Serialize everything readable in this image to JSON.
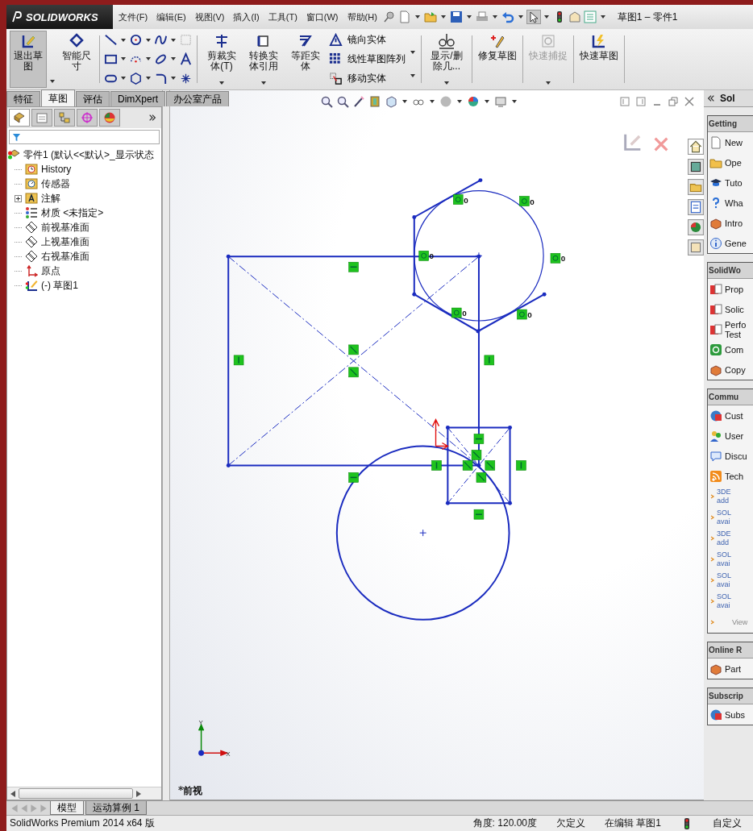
{
  "app": {
    "logo": "SOLIDWORKS",
    "menus": [
      "文件(F)",
      "编辑(E)",
      "视图(V)",
      "插入(I)",
      "工具(T)",
      "窗口(W)",
      "帮助(H)"
    ],
    "title": "草图1 – 零件1"
  },
  "ribbon": {
    "exit_sketch": {
      "label": "退出草图",
      "selected": true
    },
    "smart_dimension": "智能尺寸",
    "large_buttons": [
      {
        "label": "剪裁实体(T)",
        "dropdown": true
      },
      {
        "label": "转换实体引用",
        "dropdown": true
      },
      {
        "label": "等距实体",
        "dropdown": false
      }
    ],
    "list_buttons": [
      {
        "label": "镜向实体",
        "kind": "mirror"
      },
      {
        "label": "线性草图阵列",
        "kind": "pattern"
      },
      {
        "label": "移动实体",
        "kind": "move"
      }
    ],
    "right_buttons": [
      {
        "label": "显示/删除几...",
        "kind": "relations",
        "disabled": false,
        "dropdown": true
      },
      {
        "label": "修复草图",
        "kind": "repair",
        "disabled": false,
        "dropdown": false
      },
      {
        "label": "快速捕捉",
        "kind": "snap",
        "disabled": true,
        "dropdown": true
      },
      {
        "label": "快速草图",
        "kind": "quick",
        "disabled": false,
        "dropdown": false
      }
    ]
  },
  "tabs": [
    {
      "label": "特征",
      "selected": false
    },
    {
      "label": "草图",
      "selected": true
    },
    {
      "label": "评估",
      "selected": false
    },
    {
      "label": "DimXpert",
      "selected": false
    },
    {
      "label": "办公室产品",
      "selected": false
    }
  ],
  "panel_tabs": [
    {
      "kind": "tree",
      "selected": true
    },
    {
      "kind": "property",
      "selected": false
    },
    {
      "kind": "config",
      "selected": false
    },
    {
      "kind": "target",
      "selected": false
    },
    {
      "kind": "display",
      "selected": false
    }
  ],
  "feature_tree": {
    "root": "零件1  (默认<<默认>_显示状态",
    "items": [
      {
        "label": "History",
        "kind": "history"
      },
      {
        "label": "传感器",
        "kind": "sensor"
      },
      {
        "label": "注解",
        "kind": "annotation",
        "expanded": false
      },
      {
        "label": "材质 <未指定>",
        "kind": "material"
      },
      {
        "label": "前视基准面",
        "kind": "plane"
      },
      {
        "label": "上视基准面",
        "kind": "plane"
      },
      {
        "label": "右视基准面",
        "kind": "plane"
      },
      {
        "label": "原点",
        "kind": "origin"
      },
      {
        "label": "(-) 草图1",
        "kind": "sketch"
      }
    ]
  },
  "graphics": {
    "relation_labels": [
      "0",
      "0",
      "0",
      "0",
      "0",
      "0"
    ],
    "triad": {
      "x": "X",
      "y": "Y"
    },
    "view_label": "*前视"
  },
  "task_pane": {
    "title": "Sol",
    "sections": [
      {
        "header": "Getting",
        "items": [
          {
            "label": "New",
            "kind": "page"
          },
          {
            "label": "Ope",
            "kind": "folder"
          },
          {
            "label": "Tuto",
            "kind": "cap"
          },
          {
            "label": "Wha",
            "kind": "help"
          },
          {
            "label": "Intro",
            "kind": "box"
          },
          {
            "label": "Gene",
            "kind": "info"
          }
        ]
      },
      {
        "header": "SolidWo",
        "items": [
          {
            "label": "Prop",
            "kind": "red"
          },
          {
            "label": "Solic",
            "kind": "red"
          },
          {
            "label": "Perfo Test",
            "kind": "red"
          },
          {
            "label": "Com",
            "kind": "green"
          },
          {
            "label": "Copy",
            "kind": "box"
          }
        ]
      },
      {
        "header": "Commu",
        "items": [
          {
            "label": "Cust",
            "kind": "globe"
          },
          {
            "label": "User",
            "kind": "users"
          },
          {
            "label": "Discu",
            "kind": "chat"
          },
          {
            "label": "Tech",
            "kind": "rss"
          },
          {
            "label": "3DE add",
            "kind": "link"
          },
          {
            "label": "SOL avai",
            "kind": "link"
          },
          {
            "label": "3DE add",
            "kind": "link"
          },
          {
            "label": "SOL avai",
            "kind": "link"
          },
          {
            "label": "SOL avai",
            "kind": "link"
          },
          {
            "label": "SOL avai",
            "kind": "link"
          },
          {
            "label": "View",
            "kind": "more"
          }
        ]
      },
      {
        "header": "Online R",
        "items": [
          {
            "label": "Part",
            "kind": "box"
          }
        ]
      },
      {
        "header": "Subscrip",
        "items": [
          {
            "label": "Subs",
            "kind": "globe"
          }
        ]
      }
    ]
  },
  "bottom_tabs": [
    {
      "label": "模型",
      "selected": true
    },
    {
      "label": "运动算例 1",
      "selected": false
    }
  ],
  "status_bar": {
    "product": "SolidWorks Premium 2014 x64 版",
    "angle": "角度: 120.00度",
    "definition": "欠定义",
    "editing": "在编辑 草图1",
    "units": "自定义"
  }
}
